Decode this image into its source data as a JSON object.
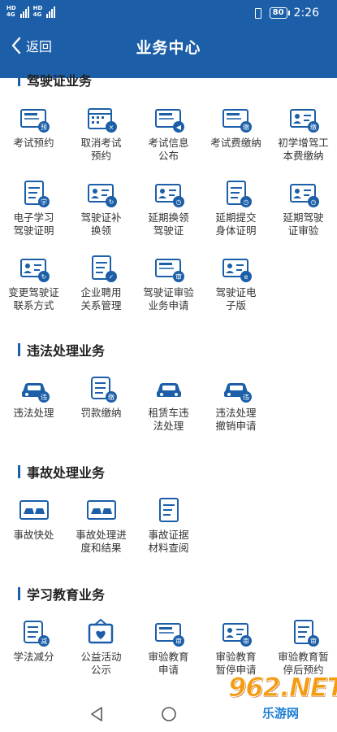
{
  "status_bar": {
    "sim1": [
      "HD",
      "4G"
    ],
    "sim2": [
      "HD",
      "4G"
    ],
    "battery": "80",
    "time": "2:26"
  },
  "nav": {
    "back_label": "返回",
    "title": "业务中心"
  },
  "sections": [
    {
      "title": "驾驶证业务",
      "items": [
        {
          "label": "考试预约",
          "icon": "card-icon",
          "badge": "预"
        },
        {
          "label": "取消考试\n预约",
          "icon": "calendar-cancel-icon",
          "badge": "×"
        },
        {
          "label": "考试信息\n公布",
          "icon": "card-speaker-icon",
          "badge": "◀"
        },
        {
          "label": "考试费缴纳",
          "icon": "card-icon",
          "badge": "缴"
        },
        {
          "label": "初学增驾工\n本费缴纳",
          "icon": "id-card-icon",
          "badge": "缴"
        },
        {
          "label": "电子学习\n驾驶证明",
          "icon": "document-icon",
          "badge": "学"
        },
        {
          "label": "驾驶证补\n换领",
          "icon": "id-card-refresh-icon",
          "badge": "↻"
        },
        {
          "label": "延期换领\n驾驶证",
          "icon": "id-card-clock-icon",
          "badge": "◷"
        },
        {
          "label": "延期提交\n身体证明",
          "icon": "document-chart-icon",
          "badge": "◷"
        },
        {
          "label": "延期驾驶\n证审验",
          "icon": "id-card-clock-icon",
          "badge": "◷"
        },
        {
          "label": "变更驾驶证\n联系方式",
          "icon": "phone-card-icon",
          "badge": "↻"
        },
        {
          "label": "企业聘用\n关系管理",
          "icon": "enterprise-doc-icon",
          "badge": "✓"
        },
        {
          "label": "驾驶证审验\n业务申请",
          "icon": "card-review-icon",
          "badge": "审"
        },
        {
          "label": "驾驶证电\n子版",
          "icon": "id-card-icon",
          "badge": "e"
        }
      ]
    },
    {
      "title": "违法处理业务",
      "items": [
        {
          "label": "违法处理",
          "icon": "car-icon",
          "badge": "违"
        },
        {
          "label": "罚款缴纳",
          "icon": "scroll-icon",
          "badge": "缴"
        },
        {
          "label": "租赁车违\n法处理",
          "icon": "car-hand-icon",
          "badge": ""
        },
        {
          "label": "违法处理\n撤销申请",
          "icon": "car-undo-icon",
          "badge": "违"
        }
      ]
    },
    {
      "title": "事故处理业务",
      "items": [
        {
          "label": "事故快处",
          "icon": "car-crash-icon",
          "badge": ""
        },
        {
          "label": "事故处理进\n度和结果",
          "icon": "crash-search-icon",
          "badge": ""
        },
        {
          "label": "事故证据\n材料查阅",
          "icon": "doc-search-icon",
          "badge": ""
        }
      ]
    },
    {
      "title": "学习教育业务",
      "items": [
        {
          "label": "学法减分",
          "icon": "notebook-icon",
          "badge": "减"
        },
        {
          "label": "公益活动\n公示",
          "icon": "charity-board-icon",
          "badge": ""
        },
        {
          "label": "审验教育\n申请",
          "icon": "card-review-icon",
          "badge": "审"
        },
        {
          "label": "审验教育\n暂停申请",
          "icon": "pause-card-icon",
          "badge": "审"
        },
        {
          "label": "审验教育暂\n停后预约",
          "icon": "clock-doc-icon",
          "badge": "审"
        }
      ]
    }
  ],
  "watermark": {
    "brand": "962.NET",
    "sub": "乐游网"
  }
}
